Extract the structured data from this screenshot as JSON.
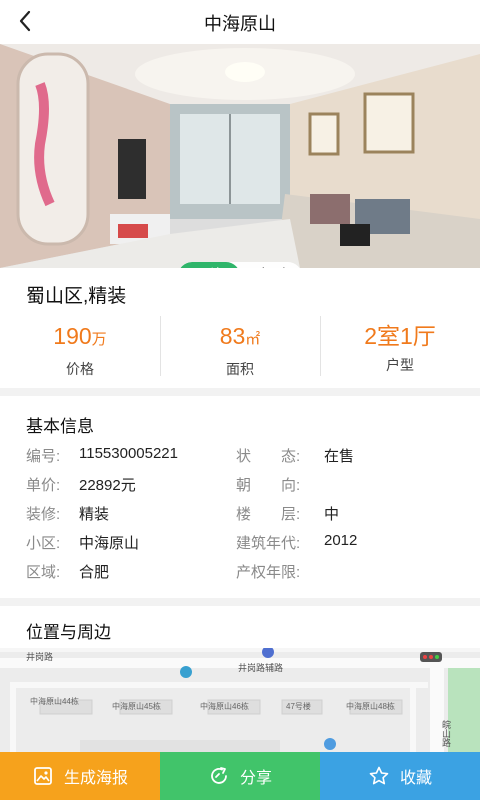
{
  "header": {
    "title": "中海原山",
    "back_icon": "chevron-left-icon"
  },
  "gallery": {
    "tabs": [
      {
        "label": "图片",
        "active": true
      },
      {
        "label": "户型",
        "active": false
      }
    ],
    "page_count": 4,
    "active_page": 2
  },
  "community_title": "蜀山区,精装",
  "stats": [
    {
      "value": "190",
      "unit": "万",
      "label": "价格"
    },
    {
      "value": "83",
      "unit": "㎡",
      "label": "面积"
    },
    {
      "value": "2室1厅",
      "unit": "",
      "label": "户型"
    }
  ],
  "basic_info": {
    "title": "基本信息",
    "rows": [
      {
        "k1": "编号:",
        "v1": "115530005221",
        "k2": "状　　态:",
        "v2": "在售"
      },
      {
        "k1": "单价:",
        "v1": "22892元",
        "k2": "朝　　向:",
        "v2": ""
      },
      {
        "k1": "装修:",
        "v1": "精装",
        "k2": "楼　　层:",
        "v2": "中"
      },
      {
        "k1": "小区:",
        "v1": "中海原山",
        "k2": "建筑年代:",
        "v2": "2012"
      },
      {
        "k1": "区域:",
        "v1": "合肥",
        "k2": "产权年限:",
        "v2": ""
      }
    ]
  },
  "location": {
    "title": "位置与周边",
    "map_labels": [
      "井岗路",
      "井岗路辅路",
      "中海原山44栋",
      "中海原山45栋",
      "中海原山46栋",
      "47号楼",
      "中海原山48栋",
      "皖山路"
    ]
  },
  "actions": [
    {
      "label": "生成海报",
      "icon": "image-icon",
      "color": "#f6a21c"
    },
    {
      "label": "分享",
      "icon": "share-icon",
      "color": "#41c46a"
    },
    {
      "label": "收藏",
      "icon": "star-icon",
      "color": "#3ba2e3"
    }
  ]
}
